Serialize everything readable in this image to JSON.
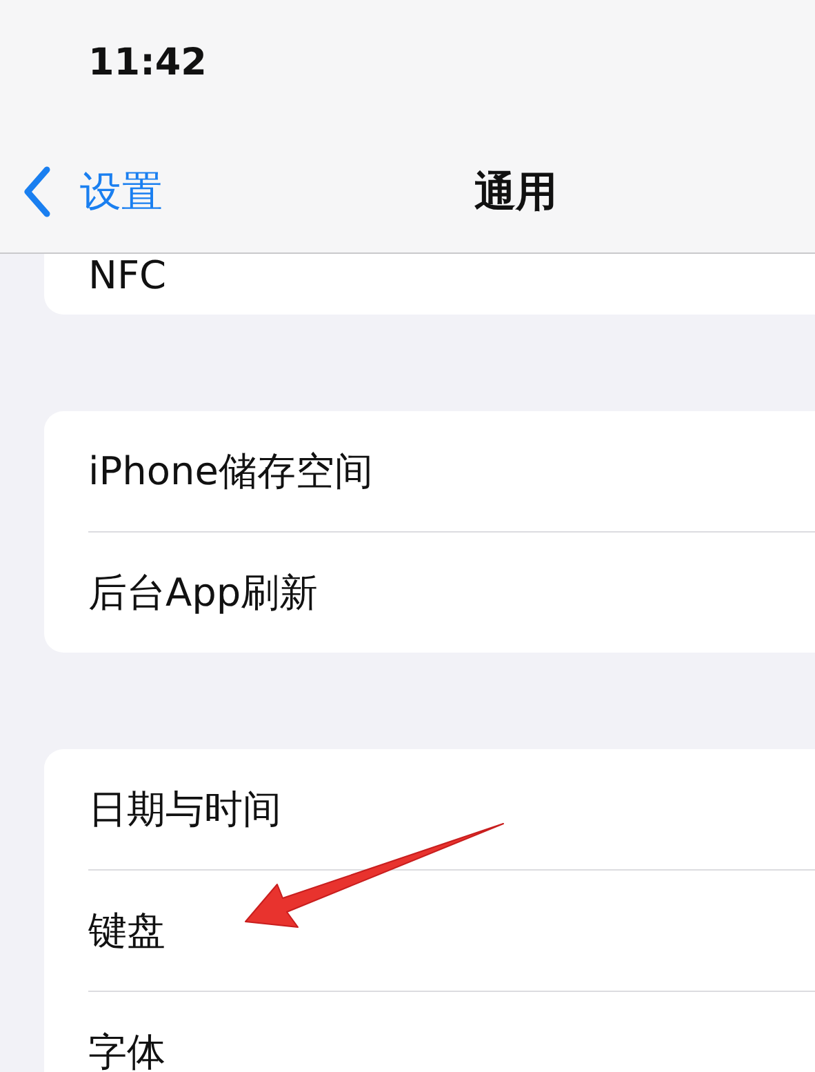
{
  "status_bar": {
    "time": "11:42"
  },
  "nav_bar": {
    "back": "设置",
    "title": "通用"
  },
  "groups": [
    {
      "items": [
        {
          "label": "NFC"
        }
      ]
    },
    {
      "items": [
        {
          "label": "iPhone储存空间"
        },
        {
          "label": "后台App刷新"
        }
      ]
    },
    {
      "items": [
        {
          "label": "日期与时间"
        },
        {
          "label": "键盘"
        },
        {
          "label": "字体"
        }
      ]
    }
  ]
}
